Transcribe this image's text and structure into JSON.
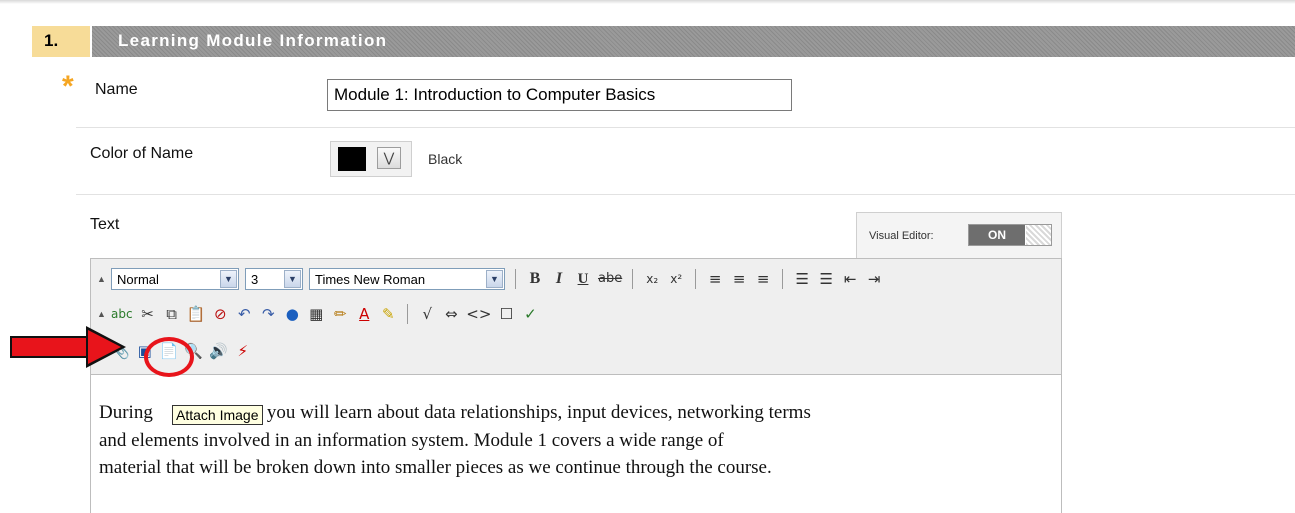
{
  "section": {
    "number": "1.",
    "title": "Learning Module Information"
  },
  "fields": {
    "name": {
      "label": "Name",
      "value": "Module 1: Introduction to Computer Basics",
      "required": true
    },
    "color": {
      "label": "Color of Name",
      "swatch": "#000000",
      "value": "Black"
    },
    "text": {
      "label": "Text"
    }
  },
  "visual_editor": {
    "label": "Visual Editor:",
    "state": "ON"
  },
  "toolbar": {
    "row1": {
      "format": "Normal",
      "size": "3",
      "font": "Times New Roman",
      "bold": "B",
      "italic": "I",
      "underline": "U",
      "strikethrough": "abe",
      "subscript": "x₂",
      "superscript": "x²"
    },
    "row2": {
      "spellcheck": "abc"
    }
  },
  "tooltip": "Attach Image",
  "body_text": {
    "line1_start": "During",
    "line1_rest": "you will learn about data relationships, input devices, networking terms",
    "line2": "and elements involved in an information system.  Module 1 covers a wide range of",
    "line3": "material that will be broken down into smaller pieces as we continue through the course."
  },
  "annotation_colors": {
    "arrow": "#e8141b",
    "circle": "#e8141b"
  }
}
